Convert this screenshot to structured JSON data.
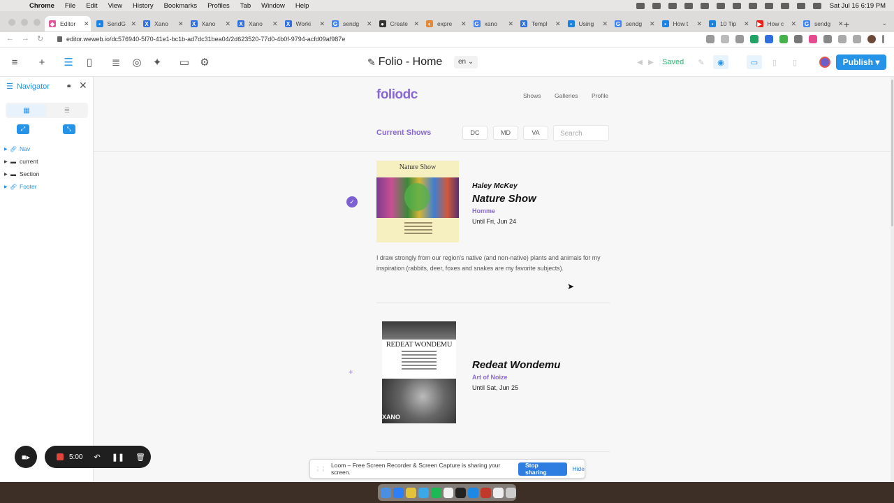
{
  "menubar": {
    "app": "Chrome",
    "items": [
      "File",
      "Edit",
      "View",
      "History",
      "Bookmarks",
      "Profiles",
      "Tab",
      "Window",
      "Help"
    ],
    "clock": "Sat Jul 16  6:19 PM"
  },
  "tabs": [
    {
      "title": "Editor",
      "color": "#e2569a",
      "glyph": "◆",
      "active": true
    },
    {
      "title": "SendG",
      "color": "#1a82e2",
      "glyph": "▪"
    },
    {
      "title": "Xano",
      "color": "#2f6ee0",
      "glyph": "X"
    },
    {
      "title": "Xano",
      "color": "#2f6ee0",
      "glyph": "X"
    },
    {
      "title": "Xano",
      "color": "#2f6ee0",
      "glyph": "X"
    },
    {
      "title": "Worki",
      "color": "#2f6ee0",
      "glyph": "X"
    },
    {
      "title": "sendg",
      "color": "#4285f4",
      "glyph": "G"
    },
    {
      "title": "Create",
      "color": "#333333",
      "glyph": "●"
    },
    {
      "title": "expre",
      "color": "#e08a3a",
      "glyph": "◐"
    },
    {
      "title": "xano",
      "color": "#4285f4",
      "glyph": "G"
    },
    {
      "title": "Templ",
      "color": "#2f6ee0",
      "glyph": "X"
    },
    {
      "title": "Using",
      "color": "#1a82e2",
      "glyph": "▪"
    },
    {
      "title": "sendg",
      "color": "#4285f4",
      "glyph": "G"
    },
    {
      "title": "How t",
      "color": "#1a82e2",
      "glyph": "▪"
    },
    {
      "title": "10 Tip",
      "color": "#1a82e2",
      "glyph": "▪"
    },
    {
      "title": "How c",
      "color": "#e62117",
      "glyph": "▶"
    },
    {
      "title": "sendg",
      "color": "#4285f4",
      "glyph": "G"
    }
  ],
  "url": "editor.weweb.io/dc576940-5f70-41e1-bc1b-ad7dc31bea04/2d623520-77d0-4b0f-9794-acfd09af987e",
  "editor": {
    "page_title": "Folio - Home",
    "language": "en",
    "save_status": "Saved",
    "publish_label": "Publish",
    "accent_color": "#2493e8"
  },
  "navigator": {
    "title": "Navigator",
    "tree": [
      {
        "label": "Nav",
        "type": "link"
      },
      {
        "label": "current",
        "type": "section"
      },
      {
        "label": "Section",
        "type": "section"
      },
      {
        "label": "Footer",
        "type": "link"
      }
    ]
  },
  "site": {
    "logo": "foliodc",
    "nav": [
      "Shows",
      "Galleries",
      "Profile"
    ],
    "current_heading": "Current Shows",
    "filters": [
      "DC",
      "MD",
      "VA"
    ],
    "search_placeholder": "Search",
    "brand_color": "#8a67d6",
    "shows": [
      {
        "artist": "Haley McKey",
        "title": "Nature Show",
        "venue": "Homme",
        "until": "Until Fri, Jun 24",
        "description": "I draw strongly from our region's native (and non-native) plants and animals for my inspiration (rabbits, deer, foxes and snakes are my favorite subjects).",
        "poster_title": "Nature Show"
      },
      {
        "artist": "",
        "title": "Redeat Wondemu",
        "venue": "Art of Noize",
        "until": "Until Sat, Jun 25",
        "description": "",
        "poster_title": "REDEAT WONDEMU",
        "poster_mark": "XANO"
      }
    ]
  },
  "loom": {
    "timer": "5:00",
    "banner": "Loom – Free Screen Recorder & Screen Capture is sharing your screen.",
    "stop_label": "Stop sharing",
    "hide_label": "Hide"
  }
}
